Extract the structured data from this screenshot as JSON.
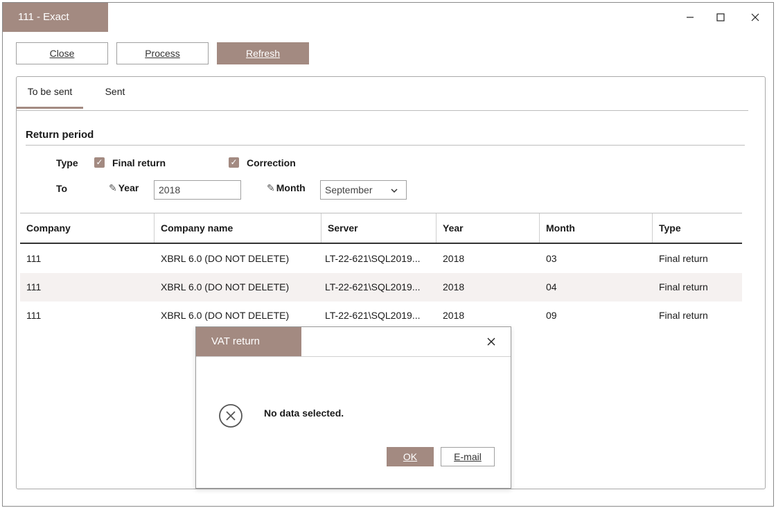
{
  "window": {
    "title": "111  - Exact"
  },
  "toolbar": {
    "close": "Close",
    "process": "Process",
    "refresh": "Refresh"
  },
  "tabs": [
    {
      "label": "To be sent",
      "active": true
    },
    {
      "label": "Sent",
      "active": false
    }
  ],
  "return_period": {
    "title": "Return period",
    "type_label": "Type",
    "final_return_label": "Final return",
    "final_return_checked": true,
    "correction_label": "Correction",
    "correction_checked": true,
    "to_label": "To",
    "year_label": "Year",
    "year_value": "2018",
    "month_label": "Month",
    "month_value": "September"
  },
  "grid": {
    "columns": [
      "Company",
      "Company name",
      "Server",
      "Year",
      "Month",
      "Type"
    ],
    "rows": [
      [
        "111",
        "XBRL 6.0 (DO NOT DELETE)",
        "LT-22-621\\SQL2019...",
        "2018",
        "03",
        "Final return"
      ],
      [
        "111",
        "XBRL 6.0 (DO NOT DELETE)",
        "LT-22-621\\SQL2019...",
        "2018",
        "04",
        "Final return"
      ],
      [
        "111",
        "XBRL 6.0 (DO NOT DELETE)",
        "LT-22-621\\SQL2019...",
        "2018",
        "09",
        "Final return"
      ]
    ]
  },
  "dialog": {
    "title": "VAT return",
    "message": "No data selected.",
    "ok": "OK",
    "email": "E-mail"
  },
  "colors": {
    "accent": "#a38a81"
  },
  "icons": {
    "error": "circle-x-icon",
    "pen": "pen-icon",
    "dropdown": "chevron-down-icon"
  }
}
